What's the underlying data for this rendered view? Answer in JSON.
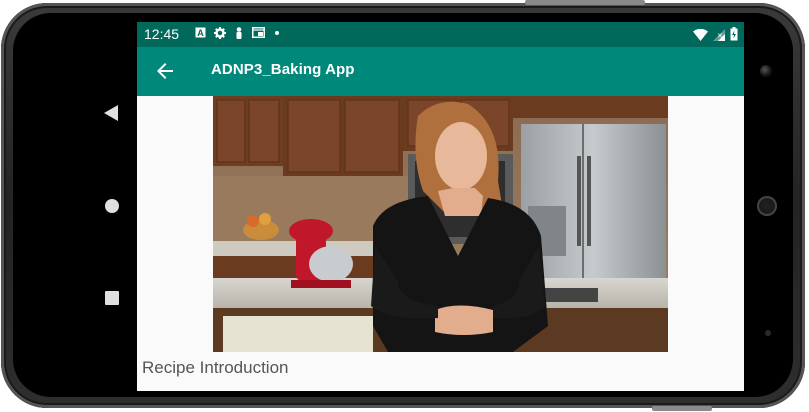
{
  "status_bar": {
    "time": "12:45",
    "icons": [
      "keyboard-a-icon",
      "gear-icon",
      "person-icon",
      "screen-cast-icon",
      "dot-icon"
    ],
    "right_icons": [
      "wifi-icon",
      "signal-icon",
      "battery-icon"
    ]
  },
  "app_bar": {
    "title": "ADNP3_Baking App",
    "back_icon": "arrow-back-icon"
  },
  "video": {
    "content": "video-frame"
  },
  "caption": "Recipe Introduction",
  "colors": {
    "status_bar": "#00695c",
    "app_bar": "#00897b",
    "background": "#fafafa"
  }
}
